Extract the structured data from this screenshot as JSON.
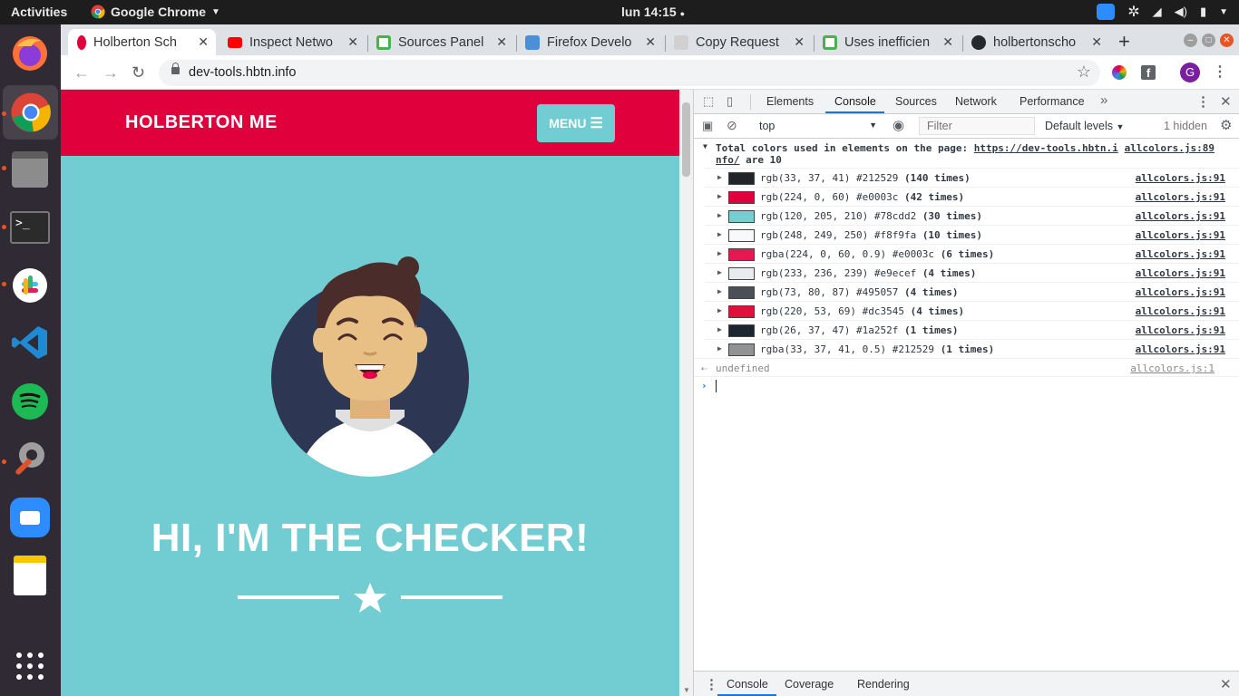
{
  "topbar": {
    "activities": "Activities",
    "app_name": "Google Chrome",
    "clock": "lun 14:15"
  },
  "dock": {
    "apps": [
      "firefox-icon",
      "chrome-icon",
      "files-icon",
      "terminal-icon",
      "slack-icon",
      "vscode-icon",
      "spotify-icon",
      "settings-icon",
      "zoom-icon",
      "notes-icon",
      "app-grid-icon"
    ]
  },
  "chrome": {
    "tabs": [
      {
        "label": "Holberton Sch",
        "icon_color": "#e0003c"
      },
      {
        "label": "Inspect Netwo",
        "icon_color": "#ff0000"
      },
      {
        "label": "Sources Panel",
        "icon_color": "#4caf50"
      },
      {
        "label": "Firefox Develo",
        "icon_color": "#4a90d9"
      },
      {
        "label": "Copy Request",
        "icon_color": "#cccccc"
      },
      {
        "label": "Uses inefficien",
        "icon_color": "#4caf50"
      },
      {
        "label": "holbertonscho",
        "icon_color": "#24292e"
      }
    ],
    "url": "dev-tools.hbtn.info",
    "profile_initial": "G"
  },
  "page": {
    "site_title": "HOLBERTON ME",
    "menu_label": "MENU",
    "hero_text": "HI, I'M THE CHECKER!",
    "colors": {
      "header": "#e0003c",
      "background": "#72cdd2"
    }
  },
  "devtools": {
    "tabs": [
      "Elements",
      "Console",
      "Sources",
      "Network",
      "Performance"
    ],
    "active_tab": "Console",
    "context": "top",
    "filter_placeholder": "Filter",
    "levels": "Default levels",
    "hidden": "1 hidden",
    "console": {
      "header_text": "Total colors used in elements on the page:",
      "header_url": "https://dev-tools.hbtn.i nfo/",
      "header_suffix": "are 10",
      "header_src": "allcolors.js:89",
      "rows": [
        {
          "text": "rgb(33, 37, 41) #212529",
          "count": "(140 times)",
          "color": "#212529",
          "src": "allcolors.js:91"
        },
        {
          "text": "rgb(224, 0, 60) #e0003c",
          "count": "(42 times)",
          "color": "#e0003c",
          "src": "allcolors.js:91"
        },
        {
          "text": "rgb(120, 205, 210) #78cdd2",
          "count": "(30 times)",
          "color": "#78cdd2",
          "src": "allcolors.js:91"
        },
        {
          "text": "rgb(248, 249, 250) #f8f9fa",
          "count": "(10 times)",
          "color": "#f8f9fa",
          "src": "allcolors.js:91"
        },
        {
          "text": "rgba(224, 0, 60, 0.9) #e0003c",
          "count": "(6 times)",
          "color": "#e31a50",
          "src": "allcolors.js:91"
        },
        {
          "text": "rgb(233, 236, 239) #e9ecef",
          "count": "(4 times)",
          "color": "#e9ecef",
          "src": "allcolors.js:91"
        },
        {
          "text": "rgb(73, 80, 87) #495057",
          "count": "(4 times)",
          "color": "#495057",
          "src": "allcolors.js:91"
        },
        {
          "text": "rgb(220, 53, 69) #dc3545",
          "count": "(4 times)",
          "color": "#e0103c",
          "src": "allcolors.js:91"
        },
        {
          "text": "rgb(26, 37, 47) #1a252f",
          "count": "(1 times)",
          "color": "#1a252f",
          "src": "allcolors.js:91"
        },
        {
          "text": "rgba(33, 37, 41, 0.5) #212529",
          "count": "(1 times)",
          "color": "#909294",
          "src": "allcolors.js:91"
        }
      ],
      "return_value": "undefined",
      "return_src": "allcolors.js:1"
    },
    "drawer_tabs": [
      "Console",
      "Coverage",
      "Rendering"
    ]
  }
}
